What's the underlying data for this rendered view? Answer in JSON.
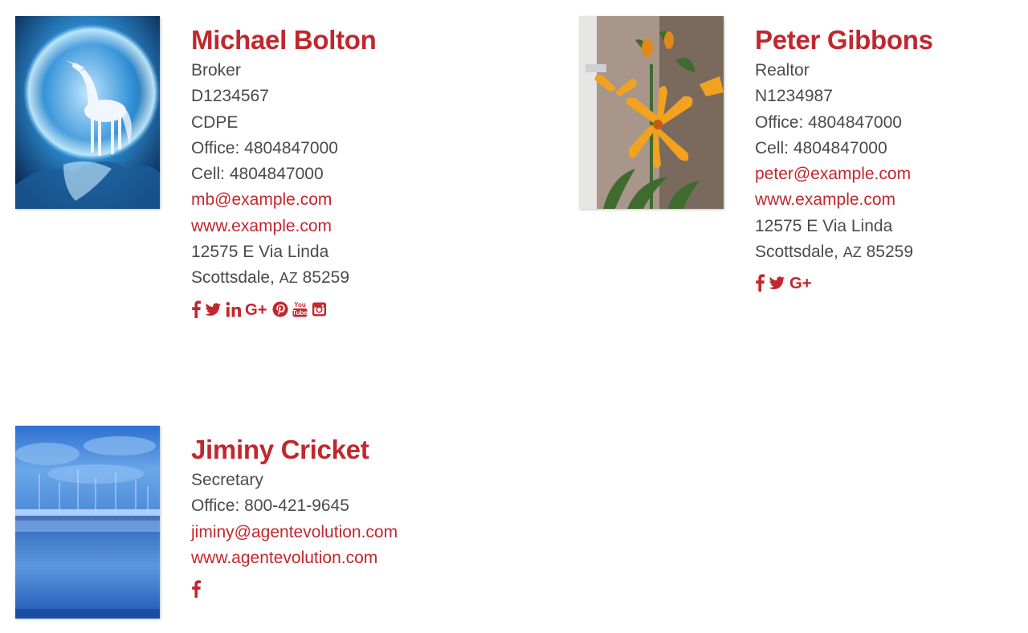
{
  "colors": {
    "accent": "#c1272d",
    "text": "#4a4a4a"
  },
  "agents": [
    {
      "name": "Michael Bolton",
      "title": "Broker",
      "license": "D1234567",
      "designation": "CDPE",
      "office": "Office: 4804847000",
      "cell": "Cell: 4804847000",
      "email": "mb@example.com",
      "website": "www.example.com",
      "street": "12575 E Via Linda",
      "city": "Scottsdale,",
      "state": "AZ",
      "zip": "85259",
      "photo_icon": "unicorn-moon-photo",
      "social": [
        "facebook-icon",
        "twitter-icon",
        "linkedin-icon",
        "google-plus-icon",
        "pinterest-icon",
        "youtube-icon",
        "instagram-icon"
      ],
      "youtube_text": [
        "You",
        "Tube"
      ],
      "google_plus_text": "G+"
    },
    {
      "name": "Peter Gibbons",
      "title": "Realtor",
      "license": "N1234987",
      "office": "Office: 4804847000",
      "cell": "Cell: 4804847000",
      "email": "peter@example.com",
      "website": "www.example.com",
      "street": "12575 E Via Linda",
      "city": "Scottsdale,",
      "state": "AZ",
      "zip": "85259",
      "photo_icon": "orange-lily-photo",
      "social": [
        "facebook-icon",
        "twitter-icon",
        "google-plus-icon"
      ],
      "google_plus_text": "G+"
    },
    {
      "name": "Jiminy Cricket",
      "title": "Secretary",
      "office": "Office: 800-421-9645",
      "email": "jiminy@agentevolution.com",
      "website": "www.agentevolution.com",
      "photo_icon": "harbor-boats-photo",
      "social": [
        "facebook-icon"
      ]
    }
  ]
}
